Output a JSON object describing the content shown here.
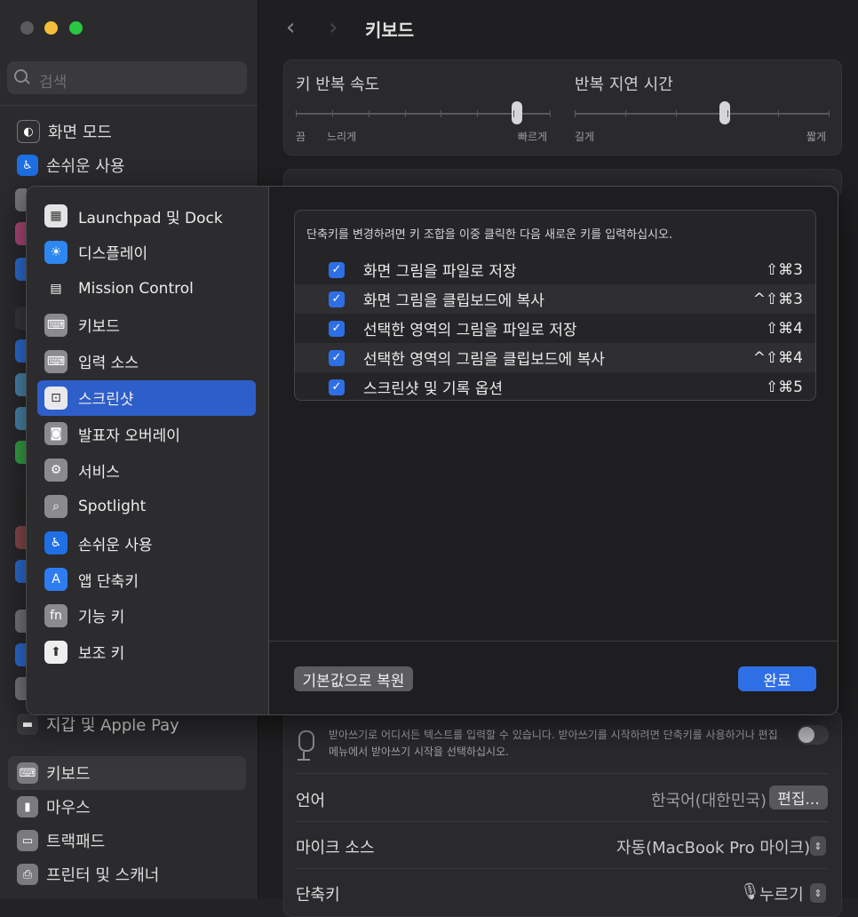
{
  "window": {
    "title": "키보드",
    "search_placeholder": "검색"
  },
  "bg_sidebar": {
    "items": [
      {
        "label": "화면 모드",
        "icon": "appearance-icon",
        "color": "#2f2f31"
      },
      {
        "label": "손쉬운 사용",
        "icon": "accessibility-icon",
        "color": "#1f6fe5"
      },
      {
        "label": "지갑 및 Apple Pay",
        "icon": "wallet-icon",
        "color": "#3b3b3d"
      },
      {
        "label": "키보드",
        "icon": "keyboard-icon",
        "color": "#7b7a7e"
      },
      {
        "label": "마우스",
        "icon": "mouse-icon",
        "color": "#7b7a7e"
      },
      {
        "label": "트랙패드",
        "icon": "trackpad-icon",
        "color": "#7b7a7e"
      },
      {
        "label": "프린터 및 스캐너",
        "icon": "printer-icon",
        "color": "#7b7a7e"
      }
    ],
    "selected": "키보드"
  },
  "key_repeat": {
    "title": "키 반복 속도",
    "left_labels": [
      "끔",
      "느리게"
    ],
    "right_label": "빠르게",
    "level": 0.87
  },
  "repeat_delay": {
    "title": "반복 지연 시간",
    "left_label": "길게",
    "right_label": "짧게",
    "level": 0.59
  },
  "dictation": {
    "description": "받아쓰기로 어디서든 텍스트를 입력할 수 있습니다. 받아쓰기를 시작하려면 단축키를 사용하거나 편집 메뉴에서 받아쓰기 시작을 선택하십시오.",
    "enabled": false,
    "rows": [
      {
        "label": "언어",
        "value": "한국어(대한민국)",
        "button": "편집..."
      },
      {
        "label": "마이크 소스",
        "value": "자동(MacBook Pro 마이크)"
      },
      {
        "label": "단축키",
        "value": "누르기"
      }
    ]
  },
  "sheet": {
    "categories": [
      {
        "label": "Launchpad 및 Dock",
        "icon": "launchpad-icon",
        "color": "#e4e4e6",
        "glyph": "▦"
      },
      {
        "label": "디스플레이",
        "icon": "display-icon",
        "color": "#2e86f0",
        "glyph": "☀"
      },
      {
        "label": "Mission Control",
        "icon": "mission-control-icon",
        "color": "#2c2c2e",
        "glyph": "▤"
      },
      {
        "label": "키보드",
        "icon": "keyboard-icon",
        "color": "#8b8a8e",
        "glyph": "⌨"
      },
      {
        "label": "입력 소스",
        "icon": "input-sources-icon",
        "color": "#8b8a8e",
        "glyph": "⌨"
      },
      {
        "label": "스크린샷",
        "icon": "screenshot-icon",
        "color": "#e9e9eb",
        "glyph": "⊡"
      },
      {
        "label": "발표자 오버레이",
        "icon": "presenter-overlay-icon",
        "color": "#8b8a8e",
        "glyph": "◙"
      },
      {
        "label": "서비스",
        "icon": "services-icon",
        "color": "#8b8a8e",
        "glyph": "⚙"
      },
      {
        "label": "Spotlight",
        "icon": "spotlight-icon",
        "color": "#8b8a8e",
        "glyph": "⌕"
      },
      {
        "label": "손쉬운 사용",
        "icon": "accessibility-icon",
        "color": "#1f6fe5",
        "glyph": "♿"
      },
      {
        "label": "앱 단축키",
        "icon": "app-store-icon",
        "color": "#2f7cf0",
        "glyph": "A"
      },
      {
        "label": "기능 키",
        "icon": "fn-icon",
        "color": "#8b8a8e",
        "glyph": "fn"
      },
      {
        "label": "보조 키",
        "icon": "modifier-keys-icon",
        "color": "#eeeeef",
        "glyph": "⬆"
      }
    ],
    "selected": "스크린샷",
    "hint": "단축키를 변경하려면 키 조합을 이중 클릭한 다음 새로운 키를 입력하십시오.",
    "shortcuts": [
      {
        "checked": true,
        "label": "화면 그림을 파일로 저장",
        "keys": "⇧⌘3"
      },
      {
        "checked": true,
        "label": "화면 그림을 클립보드에 복사",
        "keys": "^⇧⌘3"
      },
      {
        "checked": true,
        "label": "선택한 영역의 그림을 파일로 저장",
        "keys": "⇧⌘4"
      },
      {
        "checked": true,
        "label": "선택한 영역의 그림을 클립보드에 복사",
        "keys": "^⇧⌘4"
      },
      {
        "checked": true,
        "label": "스크린샷 및 기록 옵션",
        "keys": "⇧⌘5"
      }
    ],
    "restore_label": "기본값으로 복원",
    "done_label": "완료"
  }
}
